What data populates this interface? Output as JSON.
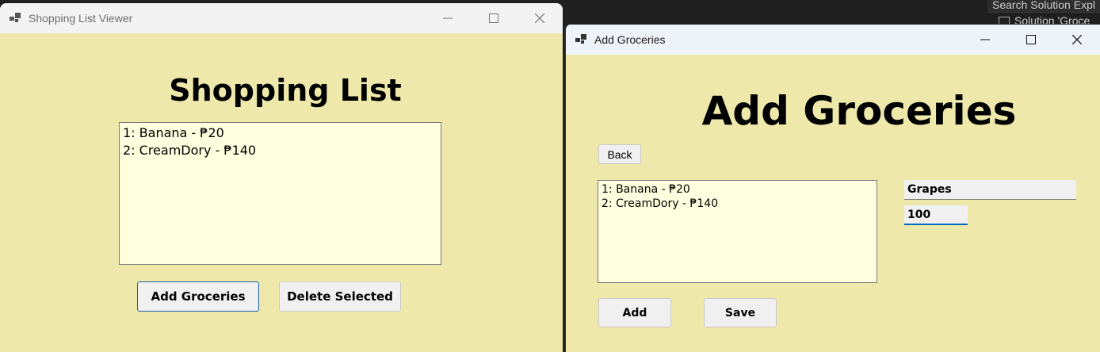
{
  "ide": {
    "search_text": "Search Solution Expl",
    "solution_text": "Solution 'Groce"
  },
  "window1": {
    "title": "Shopping List Viewer",
    "heading": "Shopping List",
    "list_items": [
      "1: Banana - ₱20",
      "2: CreamDory - ₱140"
    ],
    "add_button_label": "Add Groceries",
    "delete_button_label": "Delete Selected"
  },
  "window2": {
    "title": "Add Groceries",
    "heading": "Add Groceries",
    "back_button_label": "Back",
    "list_items": [
      "1: Banana - ₱20",
      "2: CreamDory - ₱140"
    ],
    "item_name_value": "Grapes",
    "item_price_value": "100",
    "add_button_label": "Add",
    "save_button_label": "Save"
  },
  "colors": {
    "form_background": "#eee8aa",
    "listbox_background": "#ffffe0",
    "focus_accent": "#0067c0"
  }
}
